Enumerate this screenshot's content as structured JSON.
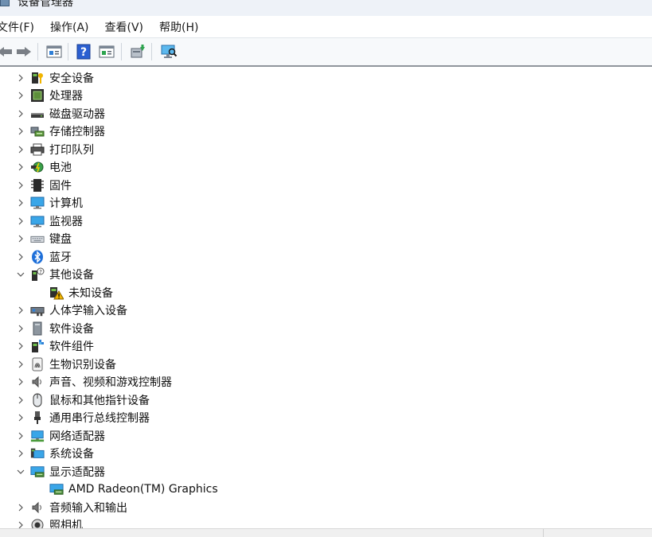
{
  "window": {
    "title": "设备管理器"
  },
  "menu": {
    "items": [
      "文件(F)",
      "操作(A)",
      "查看(V)",
      "帮助(H)"
    ]
  },
  "toolbar": {
    "icons": [
      "back-icon",
      "forward-icon",
      "properties-icon",
      "help-icon",
      "show-hidden-icon",
      "update-driver-icon",
      "scan-hardware-icon"
    ]
  },
  "colors": {
    "accent": "#2f7fd6",
    "toolbar_bg": "#f7f9fb",
    "divider": "#8f959c",
    "warning": "#f0b400"
  },
  "tree": {
    "items": [
      {
        "label": "安全设备",
        "icon": "security-device-icon",
        "expander": "collapsed"
      },
      {
        "label": "处理器",
        "icon": "processor-icon",
        "expander": "collapsed"
      },
      {
        "label": "磁盘驱动器",
        "icon": "disk-drive-icon",
        "expander": "collapsed"
      },
      {
        "label": "存储控制器",
        "icon": "storage-controller-icon",
        "expander": "collapsed"
      },
      {
        "label": "打印队列",
        "icon": "printer-icon",
        "expander": "collapsed"
      },
      {
        "label": "电池",
        "icon": "battery-icon",
        "expander": "collapsed"
      },
      {
        "label": "固件",
        "icon": "firmware-icon",
        "expander": "collapsed"
      },
      {
        "label": "计算机",
        "icon": "computer-icon",
        "expander": "collapsed"
      },
      {
        "label": "监视器",
        "icon": "monitor-icon",
        "expander": "collapsed"
      },
      {
        "label": "键盘",
        "icon": "keyboard-icon",
        "expander": "collapsed"
      },
      {
        "label": "蓝牙",
        "icon": "bluetooth-icon",
        "expander": "collapsed"
      },
      {
        "label": "其他设备",
        "icon": "other-devices-icon",
        "expander": "expanded"
      },
      {
        "label": "未知设备",
        "icon": "unknown-device-warning-icon",
        "expander": "none",
        "child": true
      },
      {
        "label": "人体学输入设备",
        "icon": "hid-icon",
        "expander": "collapsed"
      },
      {
        "label": "软件设备",
        "icon": "software-device-icon",
        "expander": "collapsed"
      },
      {
        "label": "软件组件",
        "icon": "software-component-icon",
        "expander": "collapsed"
      },
      {
        "label": "生物识别设备",
        "icon": "biometric-icon",
        "expander": "collapsed"
      },
      {
        "label": "声音、视频和游戏控制器",
        "icon": "sound-icon",
        "expander": "collapsed"
      },
      {
        "label": "鼠标和其他指针设备",
        "icon": "mouse-icon",
        "expander": "collapsed"
      },
      {
        "label": "通用串行总线控制器",
        "icon": "usb-icon",
        "expander": "collapsed"
      },
      {
        "label": "网络适配器",
        "icon": "network-adapter-icon",
        "expander": "collapsed"
      },
      {
        "label": "系统设备",
        "icon": "system-device-icon",
        "expander": "collapsed"
      },
      {
        "label": "显示适配器",
        "icon": "display-adapter-icon",
        "expander": "expanded"
      },
      {
        "label": "AMD Radeon(TM) Graphics",
        "icon": "display-adapter-icon",
        "expander": "none",
        "child": true
      },
      {
        "label": "音频输入和输出",
        "icon": "audio-io-icon",
        "expander": "collapsed"
      },
      {
        "label": "照相机",
        "icon": "camera-icon",
        "expander": "collapsed"
      }
    ]
  }
}
